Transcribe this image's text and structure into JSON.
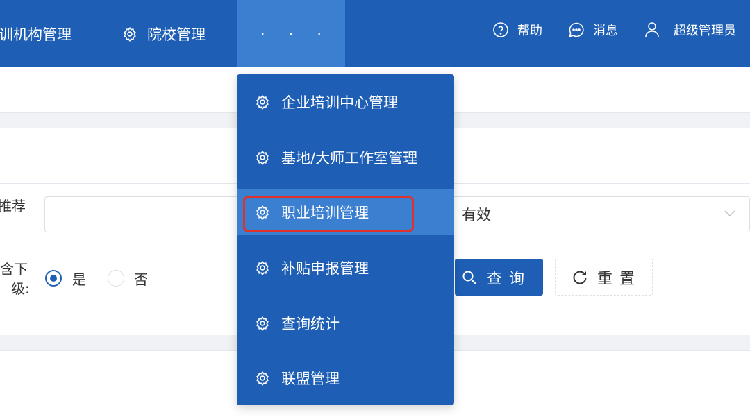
{
  "nav": {
    "item1": "训机构管理",
    "item2": "院校管理",
    "more": "· · ·",
    "help": "帮助",
    "messages": "消息",
    "user": "超级管理员"
  },
  "form": {
    "recommend_label": "推荐",
    "recommend_value": "",
    "status_value": "有效",
    "include_label_line1": "含下",
    "include_label_line2": "级:",
    "radio_yes": "是",
    "radio_no": "否",
    "include_selected": "是"
  },
  "buttons": {
    "query": "查询",
    "reset": "重置"
  },
  "dropdown": {
    "items": [
      {
        "label": "企业培训中心管理",
        "icon": "gear-icon"
      },
      {
        "label": "基地/大师工作室管理",
        "icon": "gear-icon"
      },
      {
        "label": "职业培训管理",
        "icon": "gear-icon",
        "active": true
      },
      {
        "label": "补贴申报管理",
        "icon": "gear-icon"
      },
      {
        "label": "查询统计",
        "icon": "gear-icon"
      },
      {
        "label": "联盟管理",
        "icon": "gear-icon"
      }
    ]
  },
  "colors": {
    "primary": "#1e5fb5",
    "hover": "#3b7fd0",
    "highlight": "#e0322b",
    "background_band": "#f0f2f5"
  }
}
